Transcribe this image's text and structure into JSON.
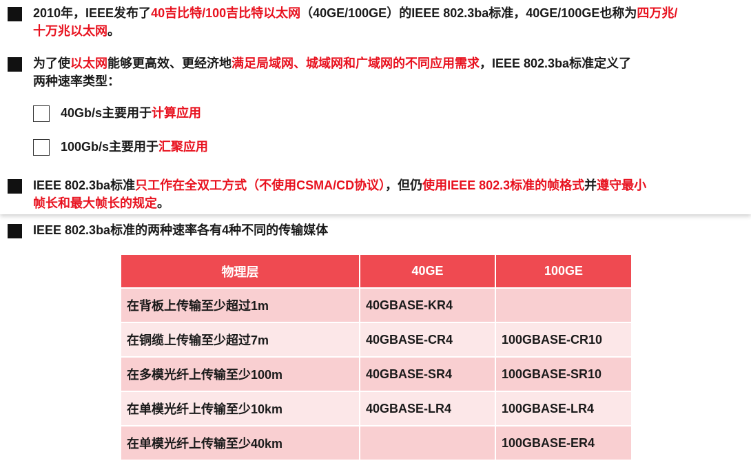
{
  "bullets": {
    "b1": {
      "line1": [
        {
          "t": "2010年，IEEE发布了",
          "red": false
        },
        {
          "t": "40吉比特/100吉比特以太网",
          "red": true
        },
        {
          "t": "（40GE/100GE）的IEEE 802.3ba标准，40GE/100GE也称为",
          "red": false
        },
        {
          "t": "四万兆/",
          "red": true
        }
      ],
      "line2": [
        {
          "t": "十万兆以太网",
          "red": true
        },
        {
          "t": "。",
          "red": false
        }
      ]
    },
    "b2": {
      "line1": [
        {
          "t": "为了使",
          "red": false
        },
        {
          "t": "以太网",
          "red": true
        },
        {
          "t": "能够更高效、更经济地",
          "red": false
        },
        {
          "t": "满足局域网、城域网和广域网的不同应用需求",
          "red": true
        },
        {
          "t": "，IEEE 802.3ba标准定义了",
          "red": false
        }
      ],
      "line2": [
        {
          "t": "两种速率类型：",
          "red": false
        }
      ]
    },
    "sub1": [
      {
        "t": "40Gb/s主要用于",
        "red": false
      },
      {
        "t": "计算应用",
        "red": true
      }
    ],
    "sub2": [
      {
        "t": "100Gb/s主要用于",
        "red": false
      },
      {
        "t": "汇聚应用",
        "red": true
      }
    ],
    "b3": {
      "line1": [
        {
          "t": "IEEE 802.3ba标准",
          "red": false
        },
        {
          "t": "只工作在全双工方式（不使用CSMA/CD协议）",
          "red": true
        },
        {
          "t": "，但仍",
          "red": false
        },
        {
          "t": "使用IEEE 802.3标准的帧格式",
          "red": true
        },
        {
          "t": "并",
          "red": false
        },
        {
          "t": "遵守最小",
          "red": true
        }
      ],
      "line2": [
        {
          "t": "帧长和最大帧长的规定",
          "red": true
        },
        {
          "t": "。",
          "red": false
        }
      ]
    },
    "b4": [
      {
        "t": "IEEE 802.3ba标准的两种速率各有4种不同的传输媒体",
        "red": false
      }
    ]
  },
  "table": {
    "headers": [
      "物理层",
      "40GE",
      "100GE"
    ],
    "rows": [
      [
        "在背板上传输至少超过1m",
        "40GBASE-KR4",
        ""
      ],
      [
        "在铜缆上传输至少超过7m",
        "40GBASE-CR4",
        "100GBASE-CR10"
      ],
      [
        "在多模光纤上传输至少100m",
        "40GBASE-SR4",
        "100GBASE-SR10"
      ],
      [
        "在单模光纤上传输至少10km",
        "40GBASE-LR4",
        "100GBASE-LR4"
      ],
      [
        "在单模光纤上传输至少40km",
        "",
        "100GBASE-ER4"
      ]
    ]
  },
  "colors": {
    "highlight": "#e8121f",
    "header_bg": "#ef4a51",
    "row_odd": "#f9cfd1",
    "row_even": "#fce7e8"
  }
}
